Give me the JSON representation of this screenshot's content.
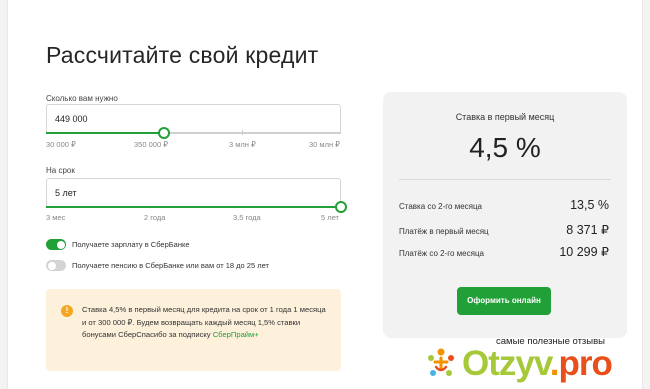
{
  "title": "Рассчитайте свой кредит",
  "amount": {
    "label": "Сколько вам нужно",
    "value": "449 000",
    "fraction": 0.4,
    "scale": [
      "30 000 ₽",
      "350 000 ₽",
      "3 млн ₽",
      "30 млн ₽"
    ]
  },
  "term": {
    "label": "На срок",
    "value": "5 лет",
    "fraction": 1.0,
    "scale": [
      "3 мес",
      "2 года",
      "3,5 года",
      "5 лет"
    ]
  },
  "toggles": [
    {
      "label": "Получаете зарплату в СберБанке",
      "on": true
    },
    {
      "label": "Получаете пенсию в СберБанке или вам от 18 до 25 лет",
      "on": false
    }
  ],
  "note": {
    "icon": "info-icon",
    "text": "Ставка 4,5% в первый месяц для кредита на срок от 1 года 1 месяца и от 300 000 ₽. Будем возвращать каждый месяц 1,5% ставки бонусами СберСпасибо за подписку",
    "link": "СберПрайм+"
  },
  "summary": {
    "first_rate_label": "Ставка в первый месяц",
    "first_rate_value": "4,5 %",
    "rows": [
      {
        "label": "Ставка со 2-го месяца",
        "value": "13,5 %"
      },
      {
        "label": "Платёж в первый месяц",
        "value": "8 371 ₽"
      },
      {
        "label": "Платёж со 2-го месяца",
        "value": "10 299 ₽"
      }
    ],
    "cta": "Оформить онлайн"
  },
  "watermark": {
    "tagline": "самые полезные отзывы",
    "brand_main": "Otzyv",
    "brand_dot": ".",
    "brand_tld": "pro"
  },
  "colors": {
    "accent": "#21a038",
    "note_bg": "#fdf1dc",
    "card_bg": "#f2f2f2"
  }
}
